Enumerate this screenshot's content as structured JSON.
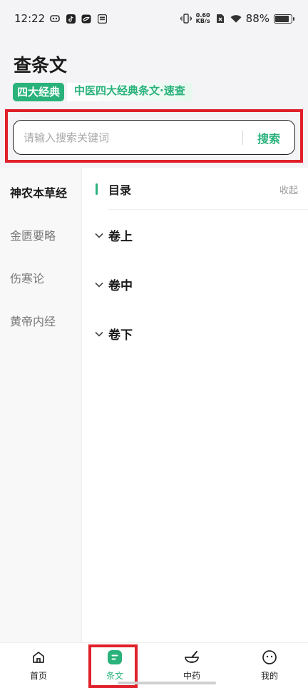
{
  "status_bar": {
    "time": "12:22",
    "net_speed_value": "0.60",
    "net_speed_unit": "KB/s",
    "battery": "88%",
    "battery_level": 0.88
  },
  "header": {
    "title": "查条文",
    "tag_badge": "四大经典",
    "tag_description": "中医四大经典条文·速查"
  },
  "search": {
    "placeholder": "请输入搜索关键词",
    "value": "",
    "button_label": "搜索"
  },
  "sidebar": {
    "items": [
      {
        "label": "神农本草经",
        "active": true
      },
      {
        "label": "金匮要略",
        "active": false
      },
      {
        "label": "伤寒论",
        "active": false
      },
      {
        "label": "黄帝内经",
        "active": false
      }
    ]
  },
  "toc": {
    "title": "目录",
    "collapse_label": "收起",
    "volumes": [
      {
        "label": "卷上"
      },
      {
        "label": "卷中"
      },
      {
        "label": "卷下"
      }
    ]
  },
  "bottom_nav": {
    "items": [
      {
        "label": "首页",
        "icon": "home-icon",
        "active": false
      },
      {
        "label": "条文",
        "icon": "article-icon",
        "active": true
      },
      {
        "label": "中药",
        "icon": "mortar-icon",
        "active": false
      },
      {
        "label": "我的",
        "icon": "profile-icon",
        "active": false
      }
    ]
  },
  "colors": {
    "accent": "#2ab27b",
    "highlight": "#e0202a",
    "background": "#f4f4f6"
  }
}
